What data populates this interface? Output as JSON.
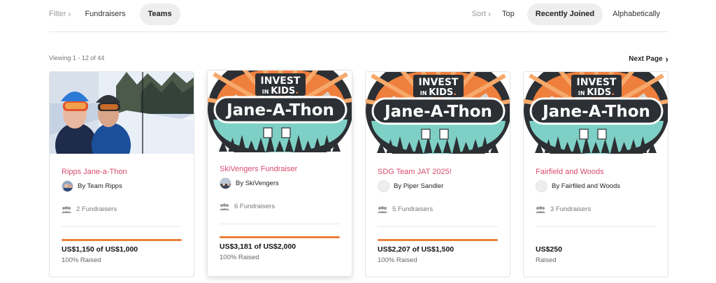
{
  "filter": {
    "label": "Filter",
    "options": [
      "Fundraisers",
      "Teams"
    ],
    "active": "Teams"
  },
  "sort": {
    "label": "Sort",
    "options": [
      "Top",
      "Recently Joined",
      "Alphabetically"
    ],
    "active": "Recently Joined"
  },
  "pagination": {
    "viewing": "Viewing 1 - 12 of 44",
    "next_label": "Next Page"
  },
  "colors": {
    "accent_pink": "#d94b70",
    "progress_orange": "#ee7f3d",
    "pill_bg": "#eeeeee"
  },
  "banner": {
    "line1": "INVEST",
    "line2_prefix": "IN",
    "line2_word": "KIDS",
    "line2_suffix": ".",
    "main": "Jane-A-Thon"
  },
  "cards": [
    {
      "title": "Ripps Jane-a-Thon",
      "owner": "By Team Ripps",
      "avatar": "team-photo",
      "fundraisers": "2 Fundraisers",
      "amount": "US$1,150 of US$1,000",
      "raised": "100% Raised",
      "progress": 1.0,
      "image": "ski-selfie"
    },
    {
      "title": "SkiVengers Fundraiser",
      "owner": "By SkiVengers",
      "avatar": "team-photo",
      "fundraisers": "6 Fundraisers",
      "amount": "US$3,181 of US$2,000",
      "raised": "100% Raised",
      "progress": 1.0,
      "image": "jane-a-thon-banner"
    },
    {
      "title": "SDG Team JAT 2025!",
      "owner": "By Piper Sandler",
      "avatar": "placeholder",
      "fundraisers": "5 Fundraisers",
      "amount": "US$2,207 of US$1,500",
      "raised": "100% Raised",
      "progress": 1.0,
      "image": "jane-a-thon-banner"
    },
    {
      "title": "Fairfield and Woods",
      "owner": "By Fairfiled and Woods",
      "avatar": "placeholder",
      "fundraisers": "3 Fundraisers",
      "amount": "US$250",
      "raised": "Raised",
      "progress": null,
      "image": "jane-a-thon-banner"
    }
  ]
}
